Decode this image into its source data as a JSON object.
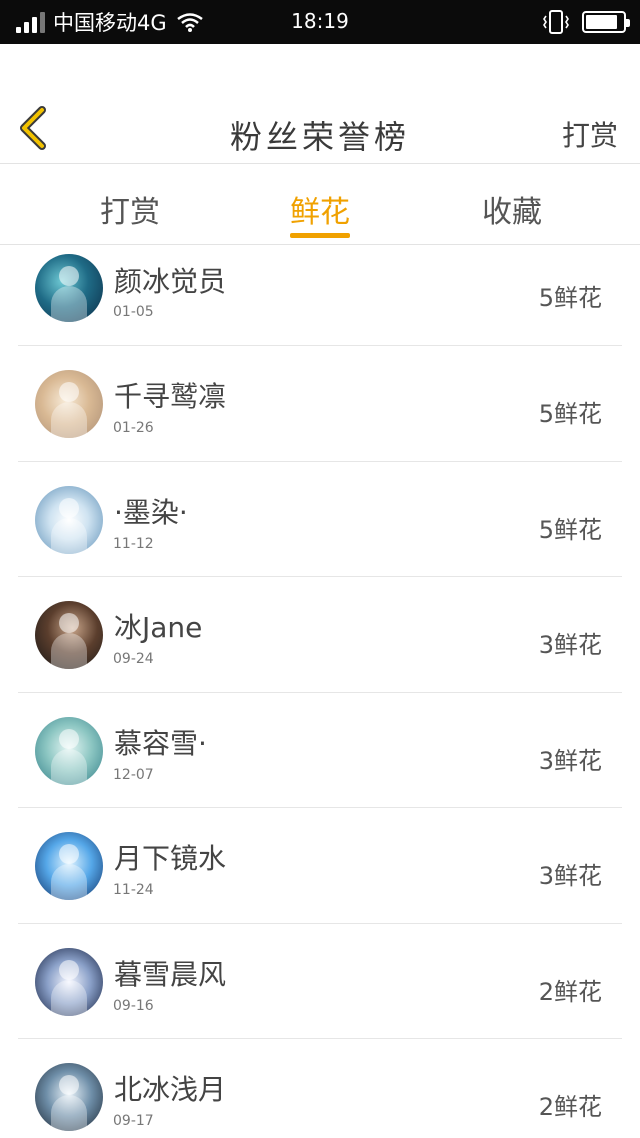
{
  "status_bar": {
    "carrier": "中国移动4G",
    "time": "18:19",
    "battery_level": 0.85
  },
  "header": {
    "title": "粉丝荣誉榜",
    "action_label": "打赏"
  },
  "tabs": [
    {
      "label": "打赏",
      "active": false
    },
    {
      "label": "鲜花",
      "active": true
    },
    {
      "label": "收藏",
      "active": false
    }
  ],
  "colors": {
    "accent": "#f0a100",
    "back_icon": "#f2c200",
    "status_bar_bg": "#0b0b0b"
  },
  "fans": [
    {
      "name": "颜冰觉员",
      "date": "01-05",
      "amount": "5鲜花"
    },
    {
      "name": "千寻鹫凛",
      "date": "01-26",
      "amount": "5鲜花"
    },
    {
      "name": "·墨染·",
      "date": "11-12",
      "amount": "5鲜花"
    },
    {
      "name": "冰Jane",
      "date": "09-24",
      "amount": "3鲜花"
    },
    {
      "name": "慕容雪·",
      "date": "12-07",
      "amount": "3鲜花"
    },
    {
      "name": "月下镜水",
      "date": "11-24",
      "amount": "3鲜花"
    },
    {
      "name": "暮雪晨风",
      "date": "09-16",
      "amount": "2鲜花"
    },
    {
      "name": "北冰浅月",
      "date": "09-17",
      "amount": "2鲜花"
    }
  ]
}
